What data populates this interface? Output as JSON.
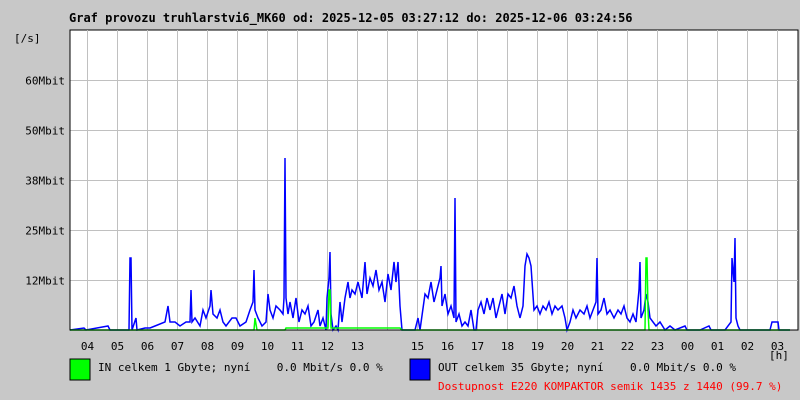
{
  "chart_data": {
    "type": "line",
    "title": "Graf provozu truhlarstvi6_MK60 od: 2025-12-05 03:27:12 do: 2025-12-06 03:24:56",
    "ylabel": "[/s]",
    "xlabel": "[h]",
    "ylim": [
      0,
      75
    ],
    "yticks": [
      {
        "v": 12.5,
        "label": "12Mbit"
      },
      {
        "v": 25,
        "label": "25Mbit"
      },
      {
        "v": 37.5,
        "label": "38Mbit"
      },
      {
        "v": 50,
        "label": "50Mbit"
      },
      {
        "v": 62.5,
        "label": "60Mbit"
      }
    ],
    "xlim_minutes": [
      0,
      1440
    ],
    "xticks": [
      {
        "m": 33,
        "label": "04"
      },
      {
        "m": 93,
        "label": "05"
      },
      {
        "m": 153,
        "label": "06"
      },
      {
        "m": 213,
        "label": "07"
      },
      {
        "m": 273,
        "label": "08"
      },
      {
        "m": 333,
        "label": "09"
      },
      {
        "m": 393,
        "label": "10"
      },
      {
        "m": 453,
        "label": "11"
      },
      {
        "m": 513,
        "label": "12"
      },
      {
        "m": 573,
        "label": "13"
      },
      {
        "m": 633,
        "label": ""
      },
      {
        "m": 693,
        "label": "15"
      },
      {
        "m": 753,
        "label": "16"
      },
      {
        "m": 813,
        "label": "17"
      },
      {
        "m": 873,
        "label": "18"
      },
      {
        "m": 933,
        "label": "19"
      },
      {
        "m": 993,
        "label": "20"
      },
      {
        "m": 1053,
        "label": "21"
      },
      {
        "m": 1113,
        "label": "22"
      },
      {
        "m": 1173,
        "label": "23"
      },
      {
        "m": 1233,
        "label": "00"
      },
      {
        "m": 1293,
        "label": "01"
      },
      {
        "m": 1353,
        "label": "02"
      },
      {
        "m": 1413,
        "label": "03"
      }
    ],
    "grid": true,
    "series": [
      {
        "name": "IN",
        "color": "#00ff00",
        "points": [
          [
            0,
            0
          ],
          [
            340,
            0
          ],
          [
            368,
            0
          ],
          [
            370,
            3
          ],
          [
            374,
            0
          ],
          [
            430,
            0
          ],
          [
            432,
            0.5
          ],
          [
            516,
            0.5
          ],
          [
            518,
            10
          ],
          [
            520,
            10
          ],
          [
            522,
            0.5
          ],
          [
            660,
            0.5
          ],
          [
            664,
            0
          ],
          [
            1150,
            0
          ],
          [
            1152,
            18
          ],
          [
            1154,
            18
          ],
          [
            1156,
            5
          ],
          [
            1158,
            0
          ],
          [
            1440,
            0
          ]
        ]
      },
      {
        "name": "OUT",
        "color": "#0000ff",
        "points": [
          [
            0,
            0
          ],
          [
            28,
            0.5
          ],
          [
            32,
            0
          ],
          [
            76,
            1
          ],
          [
            80,
            0
          ],
          [
            92,
            0
          ],
          [
            118,
            0
          ],
          [
            120,
            18
          ],
          [
            122,
            18
          ],
          [
            124,
            0
          ],
          [
            132,
            3
          ],
          [
            134,
            0
          ],
          [
            150,
            0.5
          ],
          [
            160,
            0.5
          ],
          [
            170,
            1
          ],
          [
            190,
            2
          ],
          [
            196,
            6
          ],
          [
            200,
            2
          ],
          [
            210,
            2
          ],
          [
            220,
            1
          ],
          [
            232,
            2
          ],
          [
            240,
            2
          ],
          [
            242,
            10
          ],
          [
            244,
            2
          ],
          [
            250,
            3
          ],
          [
            260,
            1
          ],
          [
            266,
            5
          ],
          [
            272,
            3
          ],
          [
            280,
            6
          ],
          [
            282,
            10
          ],
          [
            286,
            4
          ],
          [
            294,
            3
          ],
          [
            300,
            5
          ],
          [
            306,
            2
          ],
          [
            312,
            1
          ],
          [
            324,
            3
          ],
          [
            332,
            3
          ],
          [
            340,
            1
          ],
          [
            352,
            2
          ],
          [
            360,
            5
          ],
          [
            366,
            7
          ],
          [
            368,
            15
          ],
          [
            370,
            5
          ],
          [
            376,
            3
          ],
          [
            384,
            1
          ],
          [
            392,
            2
          ],
          [
            396,
            9
          ],
          [
            400,
            5
          ],
          [
            406,
            3
          ],
          [
            412,
            6
          ],
          [
            420,
            5
          ],
          [
            426,
            4
          ],
          [
            428,
            8
          ],
          [
            430,
            43
          ],
          [
            432,
            8
          ],
          [
            436,
            4
          ],
          [
            440,
            7
          ],
          [
            446,
            3
          ],
          [
            452,
            8
          ],
          [
            458,
            2
          ],
          [
            464,
            5
          ],
          [
            470,
            4
          ],
          [
            476,
            6
          ],
          [
            482,
            1
          ],
          [
            488,
            2
          ],
          [
            496,
            5
          ],
          [
            500,
            1
          ],
          [
            506,
            3
          ],
          [
            512,
            0
          ],
          [
            514,
            8
          ],
          [
            518,
            13
          ],
          [
            520,
            19.5
          ],
          [
            522,
            4
          ],
          [
            526,
            0
          ],
          [
            532,
            1
          ],
          [
            536,
            0
          ],
          [
            540,
            7
          ],
          [
            544,
            2
          ],
          [
            550,
            8
          ],
          [
            556,
            12
          ],
          [
            560,
            8
          ],
          [
            564,
            10
          ],
          [
            570,
            9
          ],
          [
            576,
            12
          ],
          [
            584,
            8
          ],
          [
            590,
            17
          ],
          [
            594,
            9
          ],
          [
            600,
            13
          ],
          [
            606,
            11
          ],
          [
            612,
            15
          ],
          [
            618,
            10
          ],
          [
            624,
            12
          ],
          [
            630,
            7
          ],
          [
            636,
            14
          ],
          [
            642,
            10
          ],
          [
            648,
            17
          ],
          [
            652,
            12
          ],
          [
            656,
            17
          ],
          [
            660,
            6
          ],
          [
            664,
            0
          ],
          [
            670,
            0
          ],
          [
            680,
            0
          ],
          [
            690,
            0
          ],
          [
            696,
            3
          ],
          [
            700,
            0
          ],
          [
            710,
            9
          ],
          [
            716,
            8
          ],
          [
            722,
            12
          ],
          [
            728,
            7
          ],
          [
            734,
            10
          ],
          [
            740,
            13
          ],
          [
            742,
            16
          ],
          [
            744,
            6
          ],
          [
            750,
            9
          ],
          [
            756,
            4
          ],
          [
            762,
            6
          ],
          [
            768,
            3
          ],
          [
            770,
            33
          ],
          [
            772,
            2
          ],
          [
            778,
            4
          ],
          [
            784,
            1
          ],
          [
            790,
            2
          ],
          [
            796,
            1
          ],
          [
            802,
            5
          ],
          [
            808,
            0
          ],
          [
            812,
            0
          ],
          [
            816,
            5
          ],
          [
            822,
            7
          ],
          [
            828,
            4
          ],
          [
            834,
            8
          ],
          [
            840,
            5
          ],
          [
            846,
            8
          ],
          [
            852,
            3
          ],
          [
            858,
            6
          ],
          [
            864,
            9
          ],
          [
            870,
            4
          ],
          [
            876,
            9
          ],
          [
            882,
            8
          ],
          [
            888,
            11
          ],
          [
            894,
            6
          ],
          [
            900,
            3
          ],
          [
            906,
            6
          ],
          [
            910,
            16
          ],
          [
            914,
            19
          ],
          [
            918,
            18
          ],
          [
            922,
            16
          ],
          [
            928,
            5
          ],
          [
            934,
            6
          ],
          [
            940,
            4
          ],
          [
            946,
            6
          ],
          [
            952,
            5
          ],
          [
            958,
            7
          ],
          [
            964,
            4
          ],
          [
            970,
            6
          ],
          [
            976,
            5
          ],
          [
            984,
            6
          ],
          [
            990,
            3
          ],
          [
            994,
            0
          ],
          [
            1000,
            2
          ],
          [
            1006,
            5
          ],
          [
            1012,
            3
          ],
          [
            1020,
            5
          ],
          [
            1028,
            4
          ],
          [
            1034,
            6
          ],
          [
            1040,
            3
          ],
          [
            1046,
            5
          ],
          [
            1052,
            7
          ],
          [
            1054,
            18
          ],
          [
            1056,
            4
          ],
          [
            1062,
            5
          ],
          [
            1068,
            8
          ],
          [
            1074,
            4
          ],
          [
            1080,
            5
          ],
          [
            1088,
            3
          ],
          [
            1096,
            5
          ],
          [
            1102,
            4
          ],
          [
            1108,
            6
          ],
          [
            1114,
            3
          ],
          [
            1120,
            2
          ],
          [
            1126,
            4
          ],
          [
            1132,
            2
          ],
          [
            1138,
            10
          ],
          [
            1140,
            17
          ],
          [
            1142,
            3
          ],
          [
            1148,
            5
          ],
          [
            1152,
            9
          ],
          [
            1156,
            7
          ],
          [
            1160,
            3
          ],
          [
            1166,
            2
          ],
          [
            1172,
            1
          ],
          [
            1180,
            2
          ],
          [
            1190,
            0
          ],
          [
            1200,
            1
          ],
          [
            1210,
            0
          ],
          [
            1230,
            1
          ],
          [
            1234,
            0
          ],
          [
            1260,
            0
          ],
          [
            1278,
            1
          ],
          [
            1282,
            0
          ],
          [
            1310,
            0
          ],
          [
            1322,
            2
          ],
          [
            1324,
            18
          ],
          [
            1328,
            12
          ],
          [
            1330,
            23
          ],
          [
            1332,
            3
          ],
          [
            1336,
            1
          ],
          [
            1340,
            0
          ],
          [
            1400,
            0
          ],
          [
            1404,
            2
          ],
          [
            1416,
            2
          ],
          [
            1418,
            0
          ],
          [
            1440,
            0
          ]
        ]
      }
    ],
    "legend": [
      {
        "series": "IN",
        "text": "IN celkem 1 Gbyte; nyní    0.0 Mbit/s 0.0 %"
      },
      {
        "series": "OUT",
        "text": "OUT celkem 35 Gbyte; nyní    0.0 Mbit/s 0.0 %"
      }
    ],
    "availability": "Dostupnost E220 KOMPAKTOR semik 1435 z 1440 (99.7 %)",
    "availability_color": "#ff0000"
  }
}
